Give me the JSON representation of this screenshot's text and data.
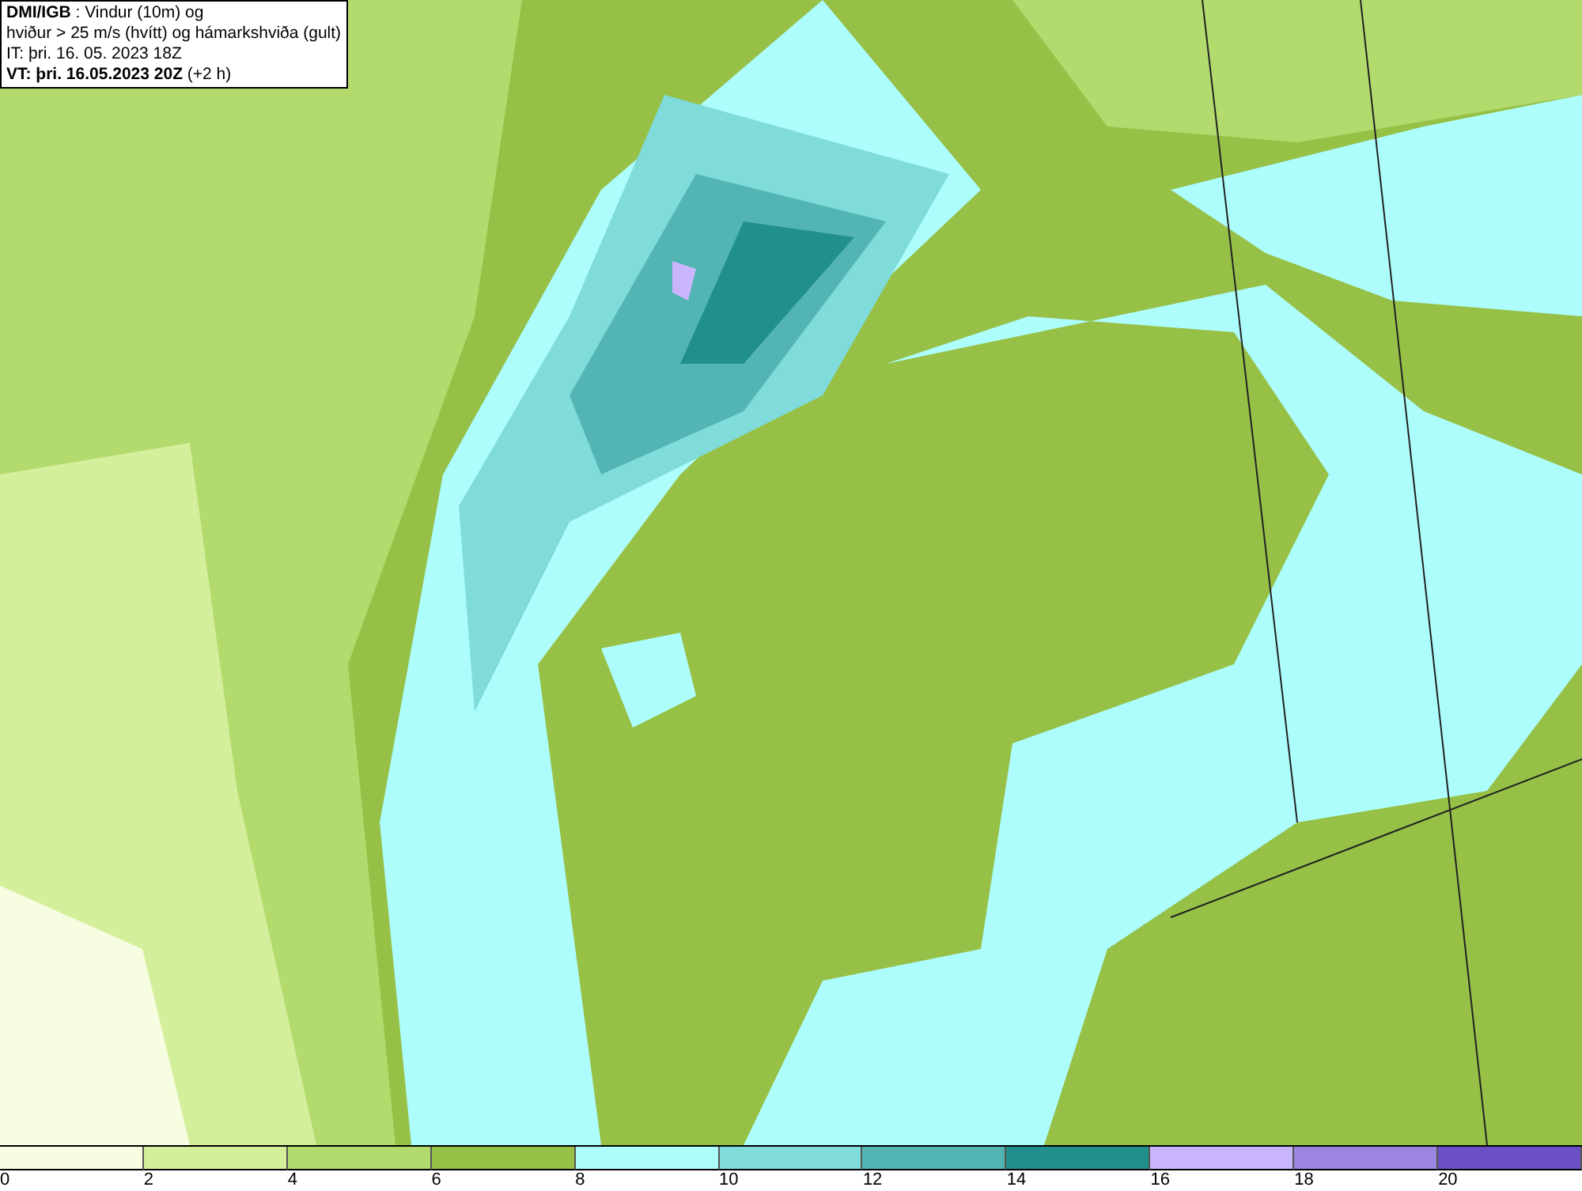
{
  "header": {
    "lines": [
      "**DMI/IGB** : Vindur (10m) og",
      "hviður > 25 m/s (hvítt) og hámarkshviða (gult)",
      "IT: þri. 16. 05. 2023 18Z",
      "**VT: þri. 16.05.2023 20Z** (+2 h)"
    ]
  },
  "colorbar": [
    {
      "label": "0",
      "color": "#f7fde0"
    },
    {
      "label": "2",
      "color": "#d4ef9b"
    },
    {
      "label": "4",
      "color": "#b2da6d"
    },
    {
      "label": "6",
      "color": "#96c046"
    },
    {
      "label": "8",
      "color": "#aefdfd"
    },
    {
      "label": "10",
      "color": "#7fdcda"
    },
    {
      "label": "12",
      "color": "#52b5b3"
    },
    {
      "label": "14",
      "color": "#21908c"
    },
    {
      "label": "16",
      "color": "#c8b5fc"
    },
    {
      "label": "18",
      "color": "#9c85e0"
    },
    {
      "label": "20",
      "color": "#6b4fc4"
    }
  ]
}
